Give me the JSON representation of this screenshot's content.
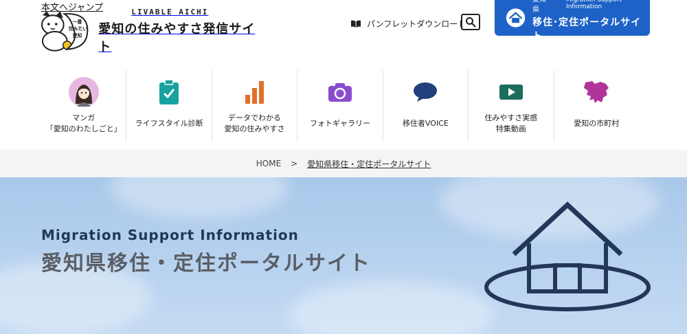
{
  "skip_link": "本文へジャンプ",
  "logo": {
    "mascot_text": [
      "一番",
      "住みたい",
      "愛知"
    ],
    "en": "LIVABLE AICHI",
    "jp": "愛知の住みやすさ発信サイト"
  },
  "header": {
    "pamphlet_label": "パンフレットダウンロード",
    "search_icon": "search-icon",
    "portal": {
      "pref": "愛知県",
      "en": "Migration Support Information",
      "title": "移住･定住ポータルサイト"
    }
  },
  "nav": [
    {
      "icon": "manga-avatar-icon",
      "lines": [
        "マンガ",
        "「愛知のわたしごと」"
      ]
    },
    {
      "icon": "clipboard-check-icon",
      "lines": [
        "ライフスタイル診断"
      ]
    },
    {
      "icon": "bar-chart-icon",
      "lines": [
        "データでわかる",
        "愛知の住みやすさ"
      ]
    },
    {
      "icon": "camera-icon",
      "lines": [
        "フォトギャラリー"
      ]
    },
    {
      "icon": "speech-bubble-icon",
      "lines": [
        "移住者VOICE"
      ]
    },
    {
      "icon": "video-play-icon",
      "lines": [
        "住みやすさ実感",
        "特集動画"
      ]
    },
    {
      "icon": "aichi-map-icon",
      "lines": [
        "愛知の市町村"
      ]
    }
  ],
  "breadcrumb": {
    "home": "HOME",
    "sep": ">",
    "current": "愛知県移住・定住ポータルサイト"
  },
  "hero": {
    "subtitle": "Migration Support Information",
    "title": "愛知県移住・定住ポータルサイト"
  },
  "colors": {
    "portal_blue": "#1e62c7",
    "teal": "#17a2a0",
    "orange": "#e0702a",
    "purple": "#8a4ccf",
    "navy": "#21407c",
    "green": "#1b6e5c",
    "magenta": "#b0349a"
  }
}
